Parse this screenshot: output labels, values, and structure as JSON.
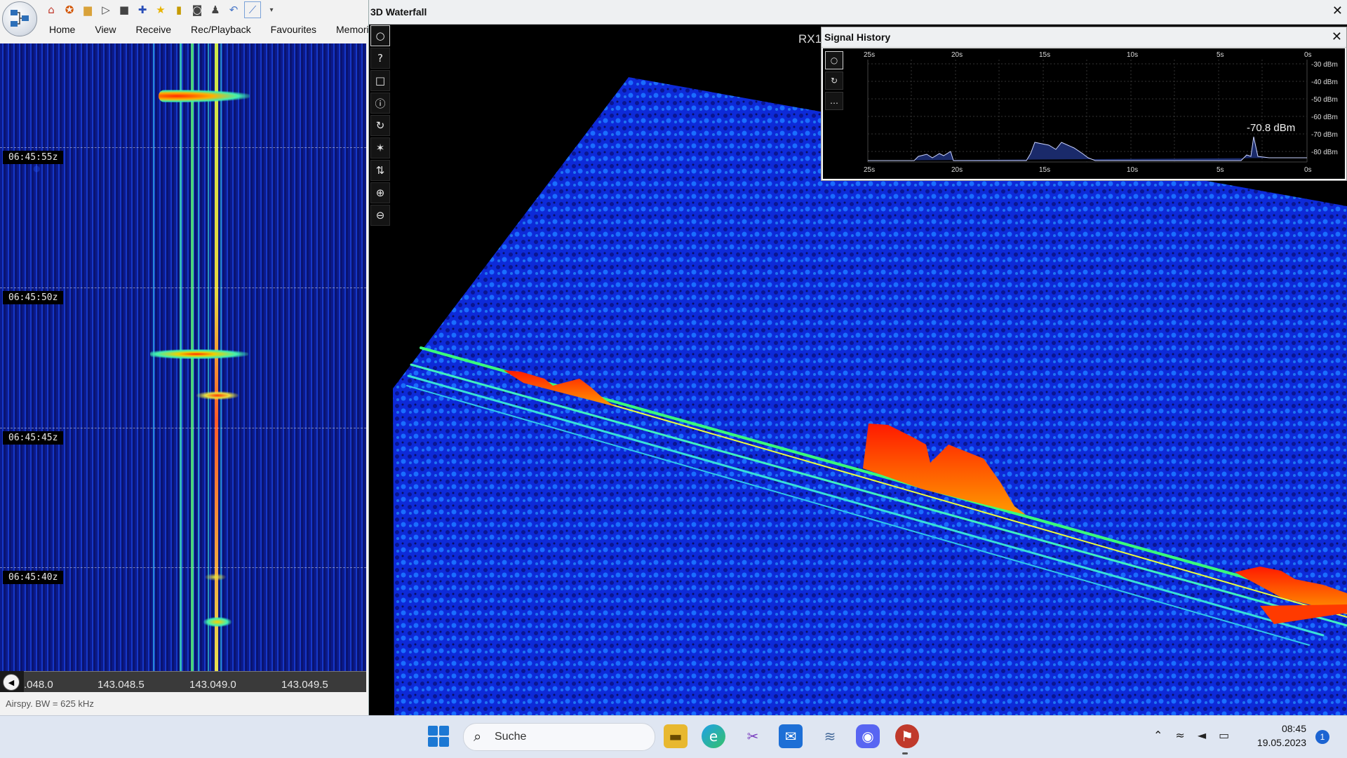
{
  "sdr": {
    "menu_tabs": [
      "Home",
      "View",
      "Receive",
      "Rec/Playback",
      "Favourites",
      "Memorie"
    ],
    "quick_access_icons": [
      "home-icon",
      "help-icon",
      "folder-icon",
      "play-icon",
      "stop-icon",
      "plus-icon",
      "star-icon",
      "lock-icon",
      "camera-icon",
      "user-icon",
      "undo-icon",
      "chart-icon",
      "dropdown-icon"
    ],
    "time_markers": [
      "06:45:55z",
      "06:45:50z",
      "06:45:45z",
      "06:45:40z"
    ],
    "freq_ticks": [
      ".048.0",
      "143.048.5",
      "143.049.0",
      "143.049.5"
    ],
    "status": "Airspy. BW = 625 kHz"
  },
  "waterfall3d": {
    "title": "3D Waterfall",
    "rx_label": "RX1",
    "toolbar": [
      "circle-icon",
      "help-icon",
      "square-icon",
      "info-icon",
      "refresh-icon",
      "star-burst-icon",
      "swap-vertical-icon",
      "zoom-in-icon",
      "zoom-out-icon"
    ]
  },
  "signal_history": {
    "title": "Signal History",
    "readout": "-70.8 dBm",
    "x_ticks": [
      "25s",
      "20s",
      "15s",
      "10s",
      "5s",
      "0s"
    ],
    "y_ticks": [
      "-30 dBm",
      "-40 dBm",
      "-50 dBm",
      "-60 dBm",
      "-70 dBm",
      "-80 dBm"
    ],
    "tools": [
      "circle-icon",
      "refresh-icon",
      "more-icon"
    ]
  },
  "taskbar": {
    "search_label": "Suche",
    "time": "08:45",
    "date": "19.05.2023",
    "notifications": "1"
  }
}
